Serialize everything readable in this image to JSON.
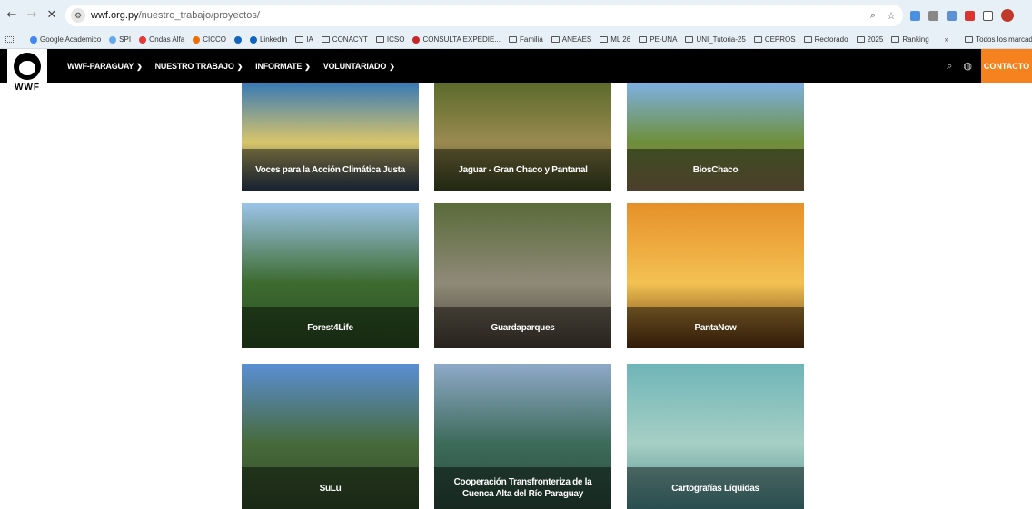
{
  "browser": {
    "url_host": "wwf.org.py",
    "url_path": "/nuestro_trabajo/proyectos/",
    "back_icon": "back-arrow-icon",
    "forward_icon": "forward-arrow-icon",
    "close_icon": "close-icon",
    "bookmarks": [
      {
        "label": "Google Académico",
        "color": "#4285f4"
      },
      {
        "label": "SPI",
        "color": "#6aa9e9"
      },
      {
        "label": "Ondas Alfa",
        "color": "#e53935"
      },
      {
        "label": "CICCO",
        "color": "#ef6c00"
      },
      {
        "label": "",
        "color": "#1565c0"
      },
      {
        "label": "LinkedIn",
        "color": "#0a66c2"
      },
      {
        "label": "IA",
        "color": ""
      },
      {
        "label": "CONACYT",
        "color": ""
      },
      {
        "label": "ICSO",
        "color": ""
      },
      {
        "label": "CONSULTA EXPEDIE...",
        "color": "#c62828"
      },
      {
        "label": "Familia",
        "color": ""
      },
      {
        "label": "ANEAES",
        "color": ""
      },
      {
        "label": "ML 26",
        "color": ""
      },
      {
        "label": "PE-UNA",
        "color": ""
      },
      {
        "label": "UNI_Tutoria-25",
        "color": ""
      },
      {
        "label": "CEPROS",
        "color": ""
      },
      {
        "label": "Rectorado",
        "color": ""
      },
      {
        "label": "2025",
        "color": ""
      },
      {
        "label": "Ranking",
        "color": ""
      }
    ],
    "more_bookmarks": "»",
    "all_bookmarks": "Todos los marcado"
  },
  "site": {
    "logo_text": "WWF",
    "menu": [
      {
        "label": "WWF-PARAGUAY"
      },
      {
        "label": "NUESTRO TRABAJO"
      },
      {
        "label": "INFORMATE"
      },
      {
        "label": "VOLUNTARIADO"
      }
    ],
    "contact_label": "CONTACTO"
  },
  "projects": [
    {
      "title": "Voces para la Acción Climática Justa",
      "colors": [
        "#3a7bb5",
        "#d8c56a",
        "#2b3d5a"
      ]
    },
    {
      "title": "Jaguar - Gran Chaco y Pantanal",
      "colors": [
        "#5c6b2c",
        "#9a8a50",
        "#3d4a20"
      ]
    },
    {
      "title": "BiosChaco",
      "colors": [
        "#7eb0e0",
        "#6e8f3a",
        "#8a7350"
      ]
    },
    {
      "title": "Forest4Life",
      "colors": [
        "#9cc4e8",
        "#3d6b2f",
        "#2a4d22"
      ]
    },
    {
      "title": "Guardaparques",
      "colors": [
        "#5a6b3a",
        "#8f8a78",
        "#4a4236"
      ]
    },
    {
      "title": "PantaNow",
      "colors": [
        "#e6902a",
        "#f3c152",
        "#5a3010"
      ]
    },
    {
      "title": "SuLu",
      "colors": [
        "#5b8fd4",
        "#476a3a",
        "#2f4a28"
      ]
    },
    {
      "title": "Cooperación Transfronteriza de la Cuenca Alta del Río Paraguay",
      "colors": [
        "#8fa9c8",
        "#3d6b5a",
        "#2a4a3a"
      ]
    },
    {
      "title": "Cartografías Líquidas",
      "colors": [
        "#6fb5b8",
        "#a6cfc4",
        "#4c8f90"
      ]
    }
  ]
}
